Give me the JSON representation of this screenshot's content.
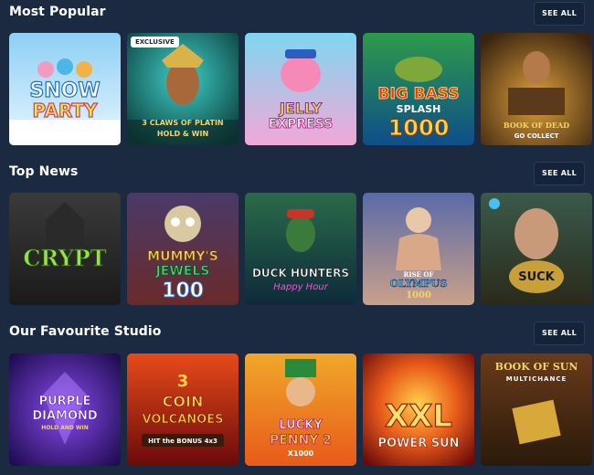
{
  "sections": [
    {
      "title": "Most Popular",
      "see_all_label": "SEE ALL",
      "games": [
        {
          "title": "SNOW PARTY",
          "lines": [
            "SNOW",
            "PARTY"
          ]
        },
        {
          "title": "3 CLAWS OF PLATIN HOLD & WIN",
          "lines": [
            "3 CLAWS OF PLATIN",
            "HOLD & WIN"
          ],
          "badge": "EXCLUSIVE"
        },
        {
          "title": "JELLY EXPRESS",
          "lines": [
            "JELLY",
            "EXPRESS"
          ]
        },
        {
          "title": "BIG BASS SPLASH 1000",
          "lines": [
            "BIG BASS",
            "SPLASH",
            "1000"
          ]
        },
        {
          "title": "BOOK OF DEAD GOLD COLLECT",
          "lines": [
            "BOOK OF DEAD",
            "GO COLLECT"
          ]
        }
      ]
    },
    {
      "title": "Top News",
      "see_all_label": "SEE ALL",
      "games": [
        {
          "title": "THE CRYPT",
          "lines": [
            "CRYPT"
          ]
        },
        {
          "title": "MUMMY'S JEWELS 100",
          "lines": [
            "MUMMY'S",
            "JEWELS",
            "100"
          ]
        },
        {
          "title": "DUCK HUNTERS HAPPY HOUR",
          "lines": [
            "DUCK HUNTERS",
            "Happy Hour"
          ]
        },
        {
          "title": "RISE OF OLYMPUS 1000",
          "lines": [
            "RISE OF",
            "OLYMPUS",
            "1000"
          ]
        },
        {
          "title": "SUCK",
          "lines": [
            "SUCK"
          ]
        }
      ]
    },
    {
      "title": "Our Favourite Studio",
      "see_all_label": "SEE ALL",
      "games": [
        {
          "title": "PURPLE DIAMOND HOLD AND WIN",
          "lines": [
            "PURPLE",
            "DIAMOND",
            "HOLD AND WIN"
          ]
        },
        {
          "title": "3 COIN VOLCANOES",
          "lines": [
            "3",
            "COIN",
            "VOLCANOES",
            "HIT the BONUS 4x3"
          ]
        },
        {
          "title": "LUCKY PENNY 2 X1000",
          "lines": [
            "LUCKY",
            "PENNY 2",
            "X1000"
          ]
        },
        {
          "title": "XXL POWER SUN",
          "lines": [
            "XXL",
            "POWER SUN"
          ]
        },
        {
          "title": "BOOK OF SUN MULTICHANCE",
          "lines": [
            "BOOK OF SUN",
            "MULTICHANCE"
          ]
        }
      ]
    }
  ],
  "colors": {
    "background": "#1b2a41",
    "button_bg": "#15233a"
  }
}
